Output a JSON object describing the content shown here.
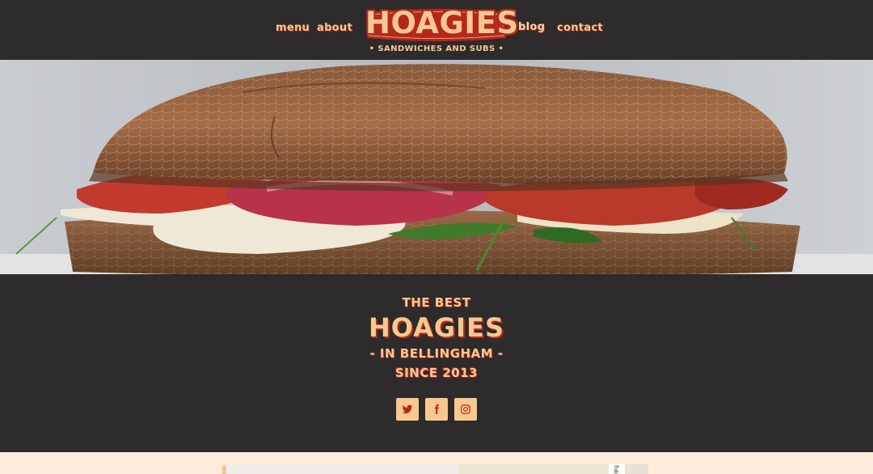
{
  "header": {
    "nav_left": [
      {
        "label": "Menu"
      },
      {
        "label": "About"
      }
    ],
    "logo_text": "HOAGIES",
    "tagline": "• Sandwiches and Subs •",
    "nav_right": [
      {
        "label": "Blog"
      },
      {
        "label": "Contact"
      }
    ]
  },
  "hero": {
    "image": "sandwich-photo"
  },
  "intro": {
    "line1": "The Best",
    "line2": "Hoagies",
    "line3": "- In Bellingham -",
    "line4": "Since 2013"
  },
  "social": [
    {
      "icon": "twitter-icon"
    },
    {
      "icon": "facebook-icon"
    },
    {
      "icon": "instagram-icon"
    }
  ],
  "map": {
    "corner_text": "har"
  },
  "colors": {
    "dark": "#2d2b2b",
    "accent": "#f8c890",
    "red": "#b5281c",
    "cream": "#fdebdc"
  }
}
